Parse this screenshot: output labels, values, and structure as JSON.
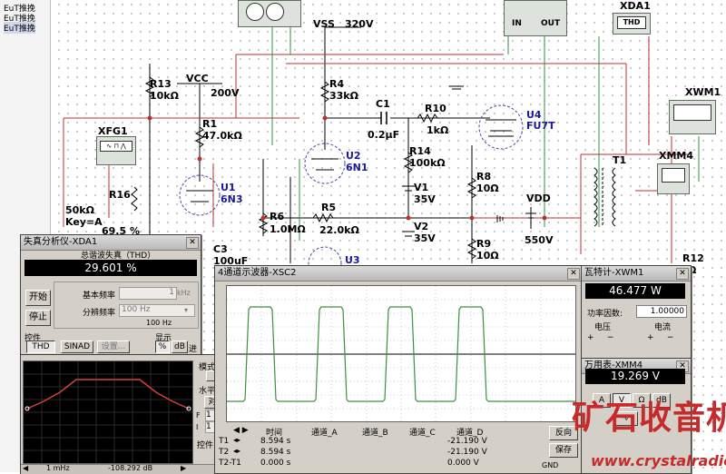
{
  "sidebar": {
    "items": [
      "EuT推挽",
      "EuT推挽",
      "EuT推挽"
    ]
  },
  "schematic": {
    "labels": {
      "vss": "VSS",
      "vss_v": "320V",
      "vcc": "VCC",
      "vcc_v": "200V",
      "r13": "R13",
      "r13_v": "10kΩ",
      "r4": "R4",
      "r4_v": "33kΩ",
      "r1": "R1",
      "r1_v": "47.0kΩ",
      "c1": "C1",
      "c1_v": "0.2µF",
      "r10": "R10",
      "r10_v": "1kΩ",
      "u4": "U4",
      "u4_t": "FU7T",
      "u2": "U2",
      "u2_t": "6N1",
      "r14": "R14",
      "r14_v": "100kΩ",
      "u1": "U1",
      "u1_t": "6N3",
      "xfg1": "XFG1",
      "r16": "R16",
      "r16_v": "50kΩ",
      "key": "Key=A",
      "pct": "69.5 %",
      "v1": "V1",
      "v1_v": "35V",
      "r8": "R8",
      "r8_v": "10Ω",
      "vdd": "VDD",
      "vdd_v": "550V",
      "r6": "R6",
      "r6_v": "1.0MΩ",
      "r5": "R5",
      "r5_v": "22.0kΩ",
      "v2": "V2",
      "v2_v": "35V",
      "r9": "R9",
      "r9_v": "10Ω",
      "u3": "U3",
      "c3": "C3",
      "c3_v": "100uF",
      "t1": "T1",
      "xda1": "XDA1",
      "thd": "THD",
      "xwm1": "XWM1",
      "xmm4": "XMM4",
      "r12": "R12",
      "r12_v": "Ω",
      "in": "IN",
      "out": "OUT"
    }
  },
  "distortion": {
    "title": "失真分析仪-XDA1",
    "heading": "总谐波失真（THD）",
    "value": "29.601 %",
    "start": "开始",
    "stop": "停止",
    "base_freq_label": "基本频率",
    "base_freq_value": "1",
    "base_freq_unit": "kHz",
    "resolution_label": "分辨频率",
    "resolution_value": "100 Hz",
    "resolution_sub": "100 Hz",
    "controls_label": "控件",
    "display_label": "显示",
    "thd_btn": "THD",
    "sinad_btn": "SINAD",
    "settings_btn": "设置...",
    "pct_btn": "%",
    "db_btn": "dB",
    "enter": "进"
  },
  "bode": {
    "side_labels": [
      "模式",
      "水平",
      "对",
      "F",
      "I",
      "控件"
    ],
    "f_value": "1",
    "i_value": "1",
    "status_freq": "1 mHz",
    "status_db": "-108.292 dB"
  },
  "oscilloscope": {
    "title": "4通道示波器-XSC2",
    "trace_color": "#3f8f3f",
    "table_headers": [
      "",
      "时间",
      "通道_A",
      "通道_B",
      "通道_C",
      "通道_D"
    ],
    "rows": [
      {
        "label": "T1",
        "time": "8.594 s",
        "a": "",
        "b": "",
        "c": "",
        "d": "-21.190 V"
      },
      {
        "label": "T2",
        "time": "8.594 s",
        "a": "",
        "b": "",
        "c": "",
        "d": "-21.190 V"
      },
      {
        "label": "T2-T1",
        "time": "0.000 s",
        "a": "",
        "b": "",
        "c": "",
        "d": "0.000 V"
      }
    ],
    "reverse_btn": "反向",
    "save_btn": "保存",
    "gnd": "GND"
  },
  "wattmeter": {
    "title": "瓦特计-XWM1",
    "value": "46.477 W",
    "pf_label": "功率因数:",
    "pf_value": "1.00000",
    "voltage_label": "电压",
    "current_label": "电流"
  },
  "multimeter": {
    "title": "万用表-XMM4",
    "value": "19.269 V",
    "buttons": [
      "A",
      "V",
      "Ω",
      "dB"
    ]
  },
  "watermark": {
    "text": "矿石收音机",
    "url": "www.crystalradio.cn"
  }
}
